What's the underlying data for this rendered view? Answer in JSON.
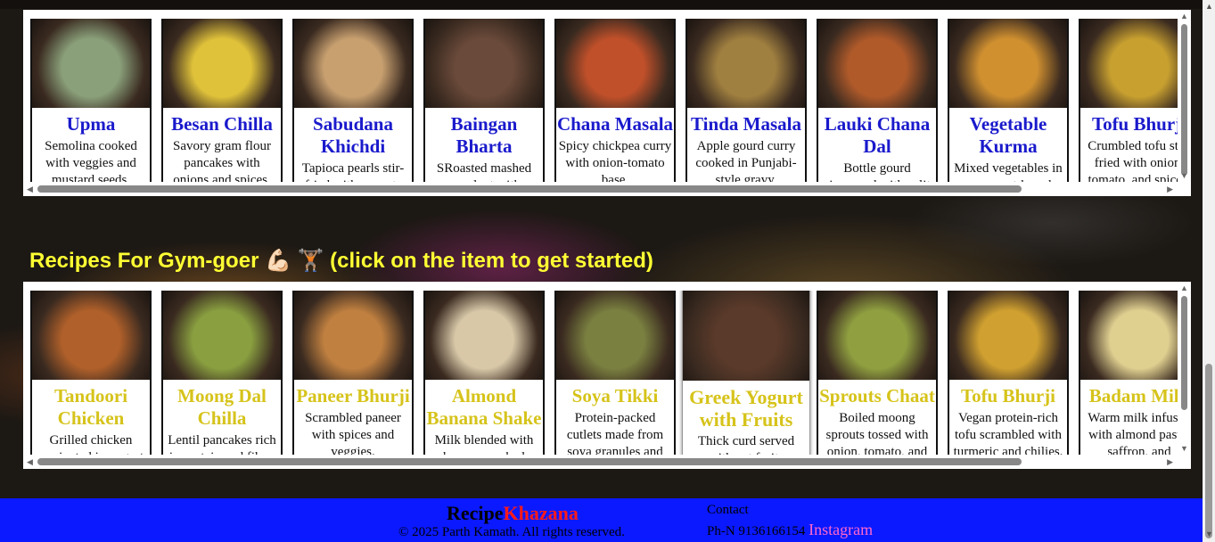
{
  "section2_heading": "Recipes For Gym-goer 💪🏻 🏋🏽  (click on the item to get started)",
  "row1": [
    {
      "title": "Upma",
      "desc": "Semolina cooked with veggies and mustard seeds.",
      "color": "#8aa07a"
    },
    {
      "title": "Besan Chilla",
      "desc": "Savory gram flour pancakes with onions and spices.",
      "color": "#e0c23a"
    },
    {
      "title": "Sabudana Khichdi",
      "desc": "Tapioca pearls stir-fried with peanuts",
      "color": "#c8a070"
    },
    {
      "title": "Baingan Bharta",
      "desc": "SRoasted mashed eggplant with",
      "color": "#6a4a3a"
    },
    {
      "title": "Chana Masala",
      "desc": "Spicy chickpea curry with onion-tomato base.",
      "color": "#c0502a"
    },
    {
      "title": "Tinda Masala",
      "desc": "Apple gourd curry cooked in Punjabi-style gravy.",
      "color": "#a08040"
    },
    {
      "title": "Lauki Chana Dal",
      "desc": "Bottle gourd simmered with split",
      "color": "#b05a2a"
    },
    {
      "title": "Vegetable Kurma",
      "desc": "Mixed vegetables in a coconut-based",
      "color": "#d09030"
    },
    {
      "title": "Tofu Bhurji",
      "desc": "Crumbled tofu stir-fried with onion, tomato, and spices.",
      "color": "#c8a030"
    }
  ],
  "row2": [
    {
      "title": "Tandoori Chicken",
      "desc": "Grilled chicken marinated in yogurt",
      "color": "#b0602a"
    },
    {
      "title": "Moong Dal Chilla",
      "desc": "Lentil pancakes rich in protein and fiber.",
      "color": "#8aa040"
    },
    {
      "title": "Paneer Bhurji",
      "desc": "Scrambled paneer with spices and veggies.",
      "color": "#c08040"
    },
    {
      "title": "Almond Banana Shake",
      "desc": "Milk blended with banana, soaked",
      "color": "#d8c8a8"
    },
    {
      "title": "Soya Tikki",
      "desc": "Protein-packed cutlets made from soya granules and",
      "color": "#7a8040"
    },
    {
      "title": "Greek Yogurt with Fruits",
      "desc": "Thick curd served with cut fruits",
      "color": "#5a3a2a"
    },
    {
      "title": "Sprouts Chaat",
      "desc": "Boiled moong sprouts tossed with onion, tomato, and",
      "color": "#90a040"
    },
    {
      "title": "Tofu Bhurji",
      "desc": "Vegan protein-rich tofu scrambled with turmeric and chilies.",
      "color": "#d0a030"
    },
    {
      "title": "Badam Milk",
      "desc": "Warm milk infused with almond paste, saffron, and",
      "color": "#e0d090"
    }
  ],
  "footer": {
    "brand_part1": "Recipe",
    "brand_part2": "Khazana",
    "copyright": "© 2025 Parth Kamath. All rights reserved.",
    "contact_title": "Contact",
    "phone": "Ph-N 9136166154",
    "instagram": "Instagram"
  }
}
